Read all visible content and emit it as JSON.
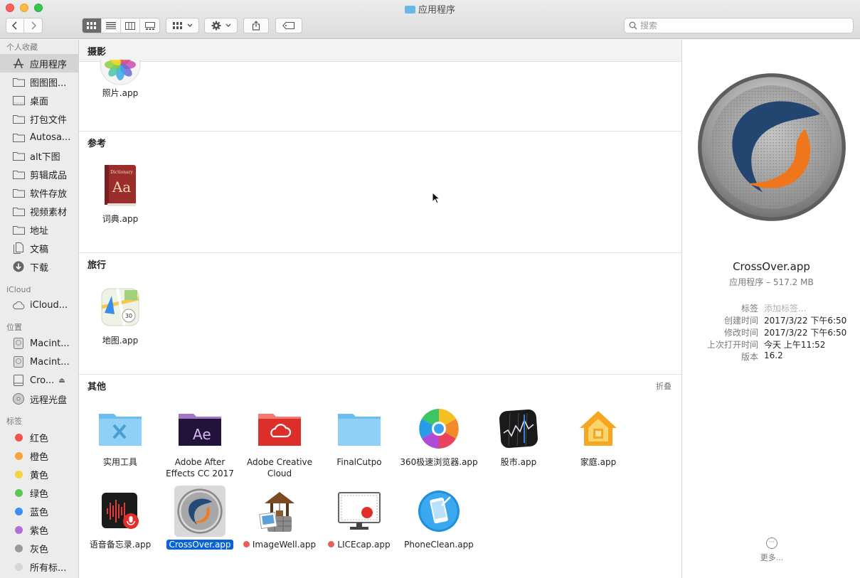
{
  "window": {
    "title": "应用程序"
  },
  "toolbar": {
    "search_placeholder": "搜索"
  },
  "sidebar": {
    "sections": [
      {
        "title": "个人收藏",
        "items": [
          {
            "label": "应用程序",
            "icon": "applications-icon",
            "selected": true
          },
          {
            "label": "图图图...",
            "icon": "folder-icon"
          },
          {
            "label": "桌面",
            "icon": "desktop-icon"
          },
          {
            "label": "打包文件",
            "icon": "folder-icon"
          },
          {
            "label": "Autosa...",
            "icon": "folder-icon"
          },
          {
            "label": "alt下图",
            "icon": "folder-icon"
          },
          {
            "label": "剪辑成品",
            "icon": "folder-icon"
          },
          {
            "label": "软件存放",
            "icon": "folder-icon"
          },
          {
            "label": "视频素材",
            "icon": "folder-icon"
          },
          {
            "label": "地址",
            "icon": "folder-icon"
          },
          {
            "label": "文稿",
            "icon": "document-icon"
          },
          {
            "label": "下载",
            "icon": "download-icon"
          }
        ]
      },
      {
        "title": "iCloud",
        "items": [
          {
            "label": "iCloud...",
            "icon": "cloud-icon"
          }
        ]
      },
      {
        "title": "位置",
        "items": [
          {
            "label": "Macint...",
            "icon": "disk-icon"
          },
          {
            "label": "Macint...",
            "icon": "disk-icon"
          },
          {
            "label": "Cro...",
            "icon": "volume-icon",
            "eject": true
          },
          {
            "label": "远程光盘",
            "icon": "optical-disc-icon"
          }
        ]
      }
    ],
    "tags_title": "标签",
    "tags": [
      {
        "label": "红色",
        "color": "#f0524f"
      },
      {
        "label": "橙色",
        "color": "#f7a23a"
      },
      {
        "label": "黄色",
        "color": "#f5d33f"
      },
      {
        "label": "绿色",
        "color": "#5bc853"
      },
      {
        "label": "蓝色",
        "color": "#3b8ff0"
      },
      {
        "label": "紫色",
        "color": "#b36cd9"
      },
      {
        "label": "灰色",
        "color": "#999999"
      },
      {
        "label": "所有标...",
        "color": "#d6d6d6"
      }
    ]
  },
  "main": {
    "groups": [
      {
        "title": "摄影",
        "items": [
          {
            "label": "照片.app",
            "icon": "photos-app-icon"
          }
        ]
      },
      {
        "title": "参考",
        "items": [
          {
            "label": "词典.app",
            "icon": "dictionary-app-icon"
          }
        ]
      },
      {
        "title": "旅行",
        "items": [
          {
            "label": "地图.app",
            "icon": "maps-app-icon"
          }
        ]
      },
      {
        "title": "其他",
        "collapse_label": "折叠",
        "items": [
          {
            "label": "实用工具",
            "icon": "utilities-folder-icon"
          },
          {
            "label": "Adobe After Effects CC 2017",
            "icon": "after-effects-folder-icon"
          },
          {
            "label": "Adobe Creative Cloud",
            "icon": "creative-cloud-folder-icon"
          },
          {
            "label": "FinalCutpo",
            "icon": "folder-icon"
          },
          {
            "label": "360极速浏览器.app",
            "icon": "browser-360-icon"
          },
          {
            "label": "股市.app",
            "icon": "stocks-app-icon"
          },
          {
            "label": "家庭.app",
            "icon": "home-app-icon"
          },
          {
            "label": "语音备忘录.app",
            "icon": "voice-memos-app-icon"
          },
          {
            "label": "CrossOver.app",
            "icon": "crossover-app-icon",
            "selected": true
          },
          {
            "label": "ImageWell.app",
            "icon": "imagewell-app-icon",
            "tag": "red"
          },
          {
            "label": "LICEcap.app",
            "icon": "licecap-app-icon",
            "tag": "red"
          },
          {
            "label": "PhoneClean.app",
            "icon": "phoneclean-app-icon"
          }
        ]
      }
    ]
  },
  "preview": {
    "name": "CrossOver.app",
    "kind": "应用程序 – 517.2 MB",
    "rows": [
      {
        "key": "标签",
        "value": "添加标签...",
        "placeholder": true
      },
      {
        "key": "创建时间",
        "value": "2017/3/22 下午6:50"
      },
      {
        "key": "修改时间",
        "value": "2017/3/22 下午6:50"
      },
      {
        "key": "上次打开时间",
        "value": "今天 上午11:52"
      },
      {
        "key": "版本",
        "value": "16.2"
      }
    ],
    "more_label": "更多..."
  }
}
